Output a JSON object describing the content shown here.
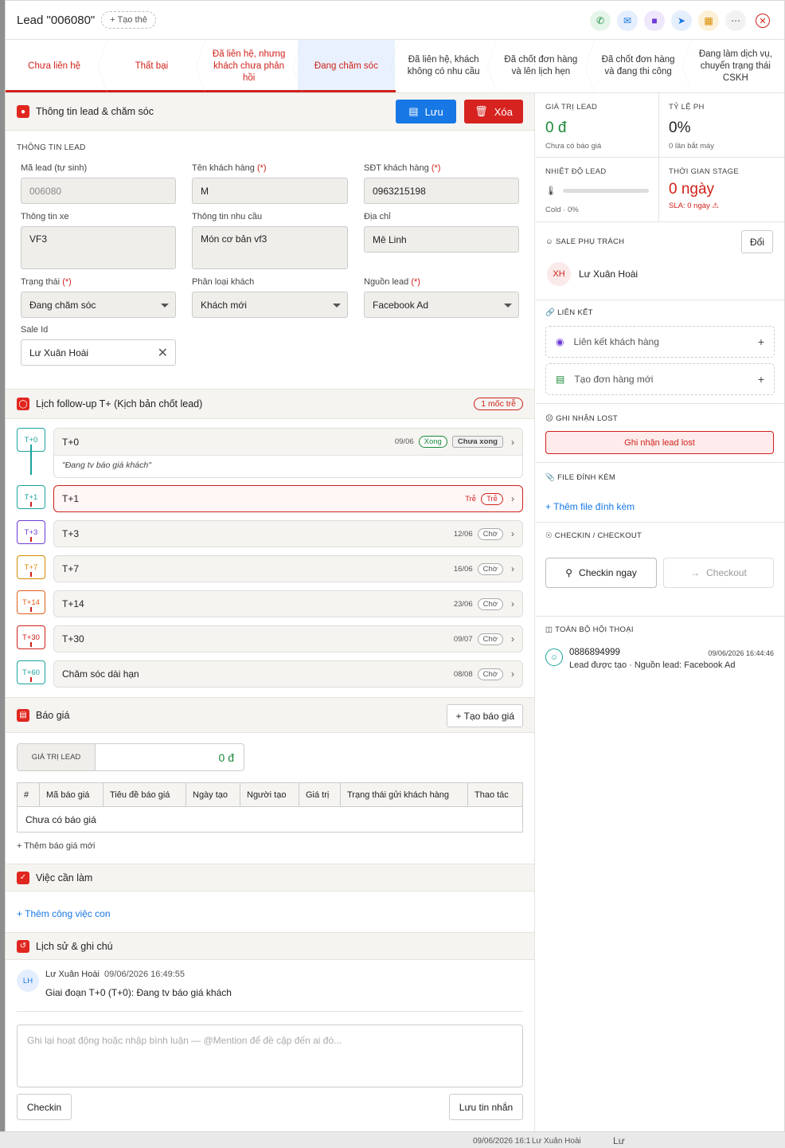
{
  "header": {
    "title": "Lead \"006080\"",
    "tag_button": "+ Tạo thẻ"
  },
  "stages": [
    "Chưa liên hệ",
    "Thất bại",
    "Đã liên hệ, nhưng khách chưa phản hồi",
    "Đang chăm sóc",
    "Đã liên hệ, khách không có nhu cầu",
    "Đã chốt đơn hàng và lên lịch hẹn",
    "Đã chốt đơn hàng và đang thi công",
    "Đang làm dịch vụ, chuyển trạng thái CSKH"
  ],
  "lead_section": {
    "title": "Thông tin lead & chăm sóc",
    "save": "Lưu",
    "delete": "Xóa",
    "subtitle": "THÔNG TIN LEAD",
    "fields": {
      "ma_lead": {
        "label": "Mã lead (tự sinh)",
        "value": "006080"
      },
      "ten_kh": {
        "label": "Tên khách hàng",
        "req": "(*)",
        "value": "M"
      },
      "sdt": {
        "label": "SĐT khách hàng",
        "req": "(*)",
        "value": "0963215198"
      },
      "xe": {
        "label": "Thông tin xe",
        "value": "VF3"
      },
      "nhu_cau": {
        "label": "Thông tin nhu cầu",
        "value": "Món cơ bản vf3"
      },
      "dia_chi": {
        "label": "Địa chỉ",
        "value": "Mê Linh"
      },
      "trang_thai": {
        "label": "Trạng thái",
        "req": "(*)",
        "value": "Đang chăm sóc"
      },
      "phan_loai": {
        "label": "Phân loại khách",
        "value": "Khách mới"
      },
      "nguon": {
        "label": "Nguồn lead",
        "req": "(*)",
        "value": "Facebook Ad"
      },
      "sale_id": {
        "label": "Sale Id",
        "value": "Lư Xuân Hoài"
      }
    }
  },
  "followup": {
    "title": "Lịch follow-up T+ (Kịch bản chốt lead)",
    "badge": "1 mốc trễ",
    "steps": [
      {
        "tag": "T+0",
        "name": "T+0",
        "date": "09/06",
        "pill1": "Xong",
        "pill2": "Chưa xong",
        "note": "\"Đang tv báo giá khách\""
      },
      {
        "tag": "T+1",
        "name": "T+1",
        "date": "Trễ",
        "pill": "Trễ"
      },
      {
        "tag": "T+3",
        "name": "T+3",
        "date": "12/06",
        "pill": "Chờ"
      },
      {
        "tag": "T+7",
        "name": "T+7",
        "date": "16/06",
        "pill": "Chờ"
      },
      {
        "tag": "T+14",
        "name": "T+14",
        "date": "23/06",
        "pill": "Chờ"
      },
      {
        "tag": "T+30",
        "name": "T+30",
        "date": "09/07",
        "pill": "Chờ"
      },
      {
        "tag": "T+60",
        "name": "Chăm sóc dài hạn",
        "date": "08/08",
        "pill": "Chờ"
      }
    ]
  },
  "quote": {
    "title": "Báo giá",
    "create": "+ Tạo báo giá",
    "value_label": "GIÁ TRỊ LEAD",
    "value": "0 đ",
    "columns": [
      "#",
      "Mã báo giá",
      "Tiêu đề báo giá",
      "Ngày tạo",
      "Người tạo",
      "Giá trị",
      "Trạng thái gửi khách hàng",
      "Thao tác"
    ],
    "empty": "Chưa có báo giá",
    "add": "+ Thêm báo giá mới"
  },
  "todo": {
    "title": "Việc cần làm",
    "add": "+ Thêm công việc con"
  },
  "history": {
    "title": "Lịch sử & ghi chú",
    "avatar": "LH",
    "author": "Lư Xuân Hoài",
    "time": "09/06/2026 16:49:55",
    "text": "Giai đoạn T+0 (T+0): Đang tv báo giá khách",
    "placeholder": "Ghi lại hoạt động hoặc nhập bình luận — @Mention để đề cập đến ai đó...",
    "checkin": "Checkin",
    "send": "Lưu tin nhắn"
  },
  "stats": {
    "gia_tri": {
      "k": "GIÁ TRỊ LEAD",
      "v": "0 đ",
      "s": "Chưa có báo giá"
    },
    "ty_le": {
      "k": "TỶ LỆ PH",
      "v": "0%",
      "s": "0 lần bắt máy"
    },
    "nhiet_do": {
      "k": "NHIỆT ĐỘ LEAD",
      "s": "Cold · 0%",
      "level": 0
    },
    "thoi_gian": {
      "k": "THỜI GIAN STAGE",
      "v": "0 ngày",
      "s": "SLA: 0 ngày ⚠"
    }
  },
  "sale": {
    "k": "SALE PHỤ TRÁCH",
    "btn": "Đổi",
    "avatar": "XH",
    "name": "Lư Xuân Hoài"
  },
  "links": {
    "k": "LIÊN KẾT",
    "customer": "Liên kết khách hàng",
    "order": "Tạo đơn hàng mới"
  },
  "lost": {
    "k": "GHI NHẬN LOST",
    "btn": "Ghi nhận lead lost"
  },
  "files": {
    "k": "FILE ĐÍNH KÈM",
    "add": "+ Thêm file đính kèm"
  },
  "checkin": {
    "k": "CHECKIN / CHECKOUT",
    "in": "Checkin ngay",
    "out": "Checkout"
  },
  "convo": {
    "k": "TOÀN BỘ HỘI THOẠI",
    "phone": "0886894999",
    "time": "09/06/2026 16:44:46",
    "text": "Lead được tạo · Nguồn lead: Facebook Ad"
  },
  "background": {
    "row_time": "09/06/2026 16:1",
    "row_user": "Lư Xuân Hoài",
    "row_short": "Lư"
  },
  "colors": {
    "accent": "#d0211b",
    "primary": "#1677e5",
    "green": "#1b8a3a"
  }
}
